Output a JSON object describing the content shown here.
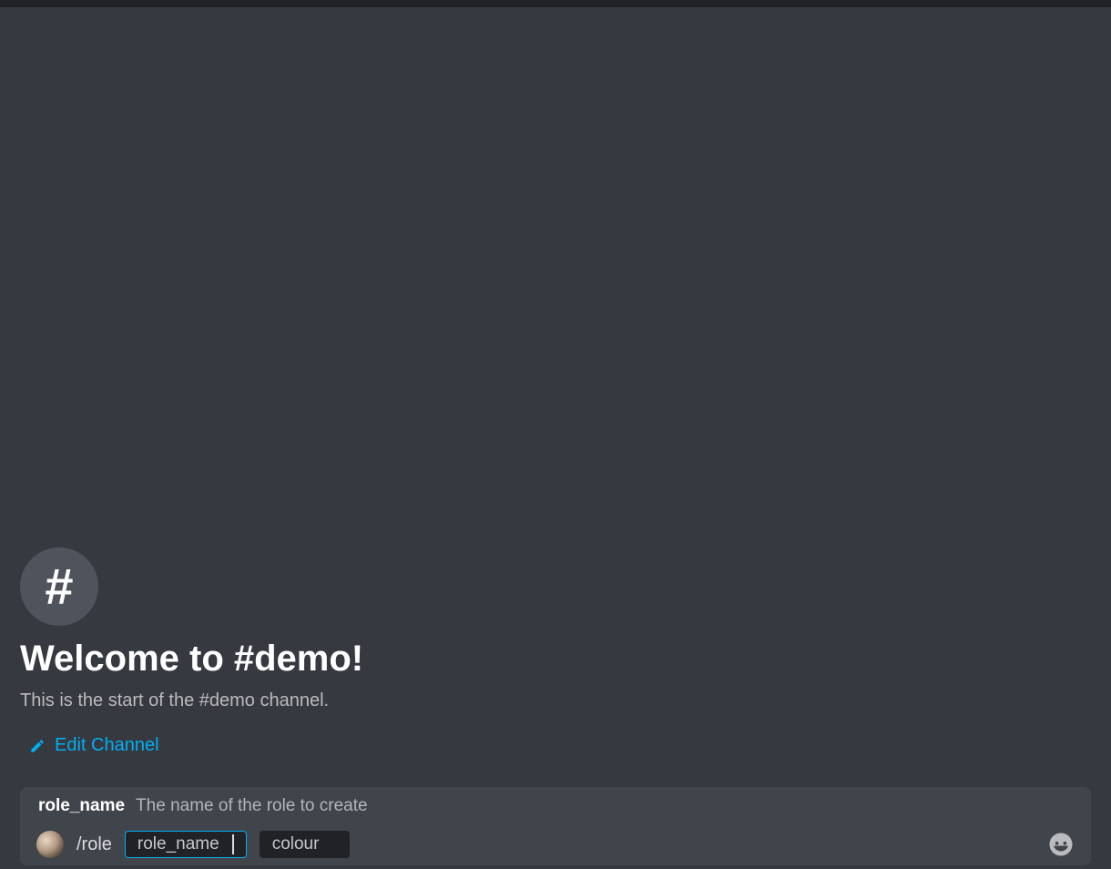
{
  "channel": {
    "hash_symbol": "#",
    "welcome_title": "Welcome to #demo!",
    "welcome_subtitle": "This is the start of the #demo channel.",
    "edit_label": "Edit Channel"
  },
  "command_hint": {
    "arg_name": "role_name",
    "description": "The name of the role to create"
  },
  "composer": {
    "command": "/role",
    "args": [
      {
        "label": "role_name",
        "active": true
      },
      {
        "label": "colour",
        "active": false
      }
    ]
  }
}
